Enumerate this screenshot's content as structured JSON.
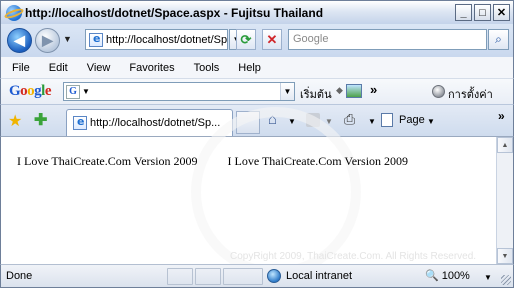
{
  "window": {
    "title": "http://localhost/dotnet/Space.aspx - Fujitsu Thailand",
    "buttons": {
      "minimize": "_",
      "maximize": "□",
      "close": "✕"
    }
  },
  "address_bar": {
    "url": "http://localhost/dotnet/Space.aspx",
    "search_placeholder": "Google"
  },
  "menu": {
    "items": [
      "File",
      "Edit",
      "View",
      "Favorites",
      "Tools",
      "Help"
    ]
  },
  "google_toolbar": {
    "logo": "Google",
    "search_label": "เริ่มต้น",
    "settings_label": "การตั้งค่า",
    "more": "»"
  },
  "tabs": {
    "items": [
      {
        "label": "http://localhost/dotnet/Sp..."
      }
    ],
    "page_menu_label": "Page",
    "more": "»"
  },
  "content": {
    "text": "I Love ThaiCreate.Com Version 2009          I Love ThaiCreate.Com Version 2009",
    "watermark": "CopyRight 2009, ThaiCreate.Com. All Rights Reserved."
  },
  "status": {
    "text": "Done",
    "zone": "Local intranet",
    "zoom": "100%"
  },
  "icons": {
    "back": "back-arrow-icon",
    "forward": "forward-arrow-icon",
    "refresh": "refresh-icon",
    "stop": "stop-icon",
    "search": "search-icon",
    "favorites": "star-icon",
    "add_favorite": "add-favorite-icon",
    "home": "home-icon",
    "feeds": "feeds-icon",
    "print": "print-icon",
    "page": "page-icon",
    "zone": "globe-icon",
    "zoom": "zoom-icon"
  },
  "colors": {
    "title_gradient_end": "#c4d3ea",
    "toolbar_bg": "#dbe6f5",
    "stop_red": "#d0262a",
    "refresh_green": "#2a9b3a"
  }
}
